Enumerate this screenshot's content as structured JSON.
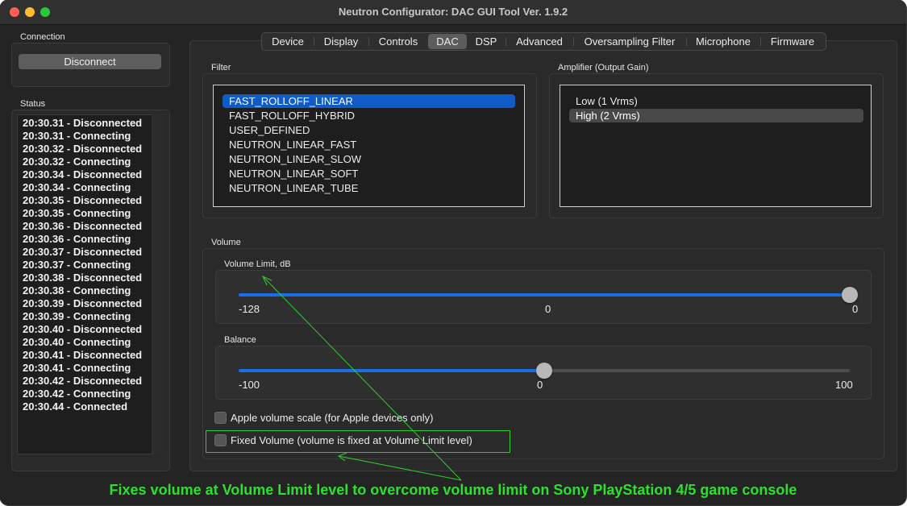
{
  "window": {
    "title": "Neutron Configurator: DAC GUI Tool Ver. 1.9.2"
  },
  "connection": {
    "label": "Connection",
    "button_label": "Disconnect"
  },
  "status": {
    "label": "Status",
    "lines": [
      "20:30.31 - Disconnected",
      "20:30.31 - Connecting",
      "20:30.32 - Disconnected",
      "20:30.32 - Connecting",
      "20:30.34 - Disconnected",
      "20:30.34 - Connecting",
      "20:30.35 - Disconnected",
      "20:30.35 - Connecting",
      "20:30.36 - Disconnected",
      "20:30.36 - Connecting",
      "20:30.37 - Disconnected",
      "20:30.37 - Connecting",
      "20:30.38 - Disconnected",
      "20:30.38 - Connecting",
      "20:30.39 - Disconnected",
      "20:30.39 - Connecting",
      "20:30.40 - Disconnected",
      "20:30.40 - Connecting",
      "20:30.41 - Disconnected",
      "20:30.41 - Connecting",
      "20:30.42 - Disconnected",
      "20:30.42 - Connecting",
      "20:30.44 - Connected"
    ]
  },
  "tabs": {
    "items": [
      "Device",
      "Display",
      "Controls",
      "DAC",
      "DSP",
      "Advanced",
      "Oversampling Filter",
      "Microphone",
      "Firmware"
    ],
    "active": "DAC"
  },
  "filter": {
    "label": "Filter",
    "items": [
      "FAST_ROLLOFF_LINEAR",
      "FAST_ROLLOFF_HYBRID",
      "USER_DEFINED",
      "NEUTRON_LINEAR_FAST",
      "NEUTRON_LINEAR_SLOW",
      "NEUTRON_LINEAR_SOFT",
      "NEUTRON_LINEAR_TUBE"
    ],
    "selected": "FAST_ROLLOFF_LINEAR"
  },
  "amplifier": {
    "label": "Amplifier (Output Gain)",
    "items": [
      "Low (1 Vrms)",
      "High (2 Vrms)"
    ],
    "selected": "High (2 Vrms)"
  },
  "volume": {
    "label": "Volume",
    "volume_limit": {
      "label": "Volume Limit, dB",
      "min_label": "-128",
      "mid_label": "0",
      "max_label": "0",
      "min": -128,
      "max": 0,
      "value": 0
    },
    "balance": {
      "label": "Balance",
      "min_label": "-100",
      "mid_label": "0",
      "max_label": "100",
      "min": -100,
      "max": 100,
      "value": 0
    },
    "apple_scale": {
      "label": "Apple volume scale (for Apple devices only)",
      "checked": false
    },
    "fixed_volume": {
      "label": "Fixed Volume (volume is fixed at Volume Limit level)",
      "checked": false
    }
  },
  "annotation": {
    "text": "Fixes volume at Volume Limit level to overcome volume limit on Sony PlayStation 4/5 game console",
    "color": "#2ee02e"
  },
  "colors": {
    "accent": "#1a6ee6",
    "selection": "#0f5cc8"
  }
}
